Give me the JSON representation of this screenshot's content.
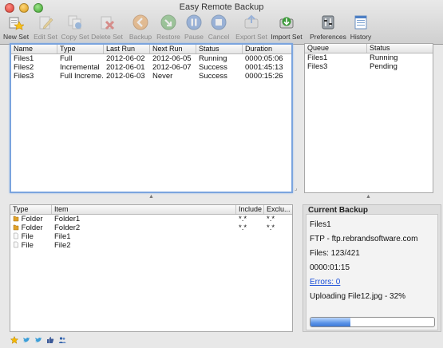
{
  "window": {
    "title": "Easy Remote Backup"
  },
  "toolbar": {
    "items": [
      {
        "label": "New Set",
        "icon": "new-set-icon",
        "enabled": true
      },
      {
        "label": "Edit Set",
        "icon": "edit-set-icon",
        "enabled": false
      },
      {
        "label": "Copy Set",
        "icon": "copy-set-icon",
        "enabled": false
      },
      {
        "label": "Delete Set",
        "icon": "delete-set-icon",
        "enabled": false
      },
      {
        "label": "Backup",
        "icon": "backup-icon",
        "enabled": false
      },
      {
        "label": "Restore",
        "icon": "restore-icon",
        "enabled": false
      },
      {
        "label": "Pause",
        "icon": "pause-icon",
        "enabled": false
      },
      {
        "label": "Cancel",
        "icon": "cancel-icon",
        "enabled": false
      },
      {
        "label": "Export Set",
        "icon": "export-set-icon",
        "enabled": false
      },
      {
        "label": "Import Set",
        "icon": "import-set-icon",
        "enabled": true
      },
      {
        "label": "Preferences",
        "icon": "preferences-icon",
        "enabled": true
      },
      {
        "label": "History",
        "icon": "history-icon",
        "enabled": true
      }
    ]
  },
  "sets_table": {
    "headers": [
      "Name",
      "Type",
      "Last Run",
      "Next Run",
      "Status",
      "Duration"
    ],
    "rows": [
      [
        "Files1",
        "Full",
        "2012-06-02",
        "2012-06-05",
        "Running",
        "0000:05:06"
      ],
      [
        "Files2",
        "Incremental",
        "2012-06-01",
        "2012-06-07",
        "Success",
        "0001:45:13"
      ],
      [
        "Files3",
        "Full Increme...",
        "2012-06-03",
        "Never",
        "Success",
        "0000:15:26"
      ]
    ]
  },
  "queue_table": {
    "headers": [
      "Queue",
      "Status"
    ],
    "rows": [
      [
        "Files1",
        "Running"
      ],
      [
        "Files3",
        "Pending"
      ]
    ]
  },
  "items_table": {
    "headers": [
      "Type",
      "Item",
      "Include",
      "Exclu..."
    ],
    "rows": [
      {
        "type": "Folder",
        "item": "Folder1",
        "include": "*.*",
        "exclude": "*.*",
        "icon": "folder-icon"
      },
      {
        "type": "Folder",
        "item": "Folder2",
        "include": "*.*",
        "exclude": "*.*",
        "icon": "folder-icon"
      },
      {
        "type": "File",
        "item": "File1",
        "include": "",
        "exclude": "",
        "icon": "file-icon"
      },
      {
        "type": "File",
        "item": "File2",
        "include": "",
        "exclude": "",
        "icon": "file-icon"
      }
    ]
  },
  "current_backup": {
    "title": "Current Backup",
    "set_name": "Files1",
    "server": "FTP - ftp.rebrandsoftware.com",
    "files": "Files: 123/421",
    "elapsed": "0000:01:15",
    "errors_link": "Errors: 0",
    "status": "Uploading File12.jpg - 32%",
    "progress": 0.32
  },
  "footer": {
    "icons": [
      "star-icon",
      "twitter-icon",
      "twitter-icon",
      "thumbs-up-icon",
      "people-icon"
    ]
  },
  "colors": {
    "focus_border": "#7ba4de",
    "link": "#1b4fd8",
    "progress": "#5b94e8"
  }
}
